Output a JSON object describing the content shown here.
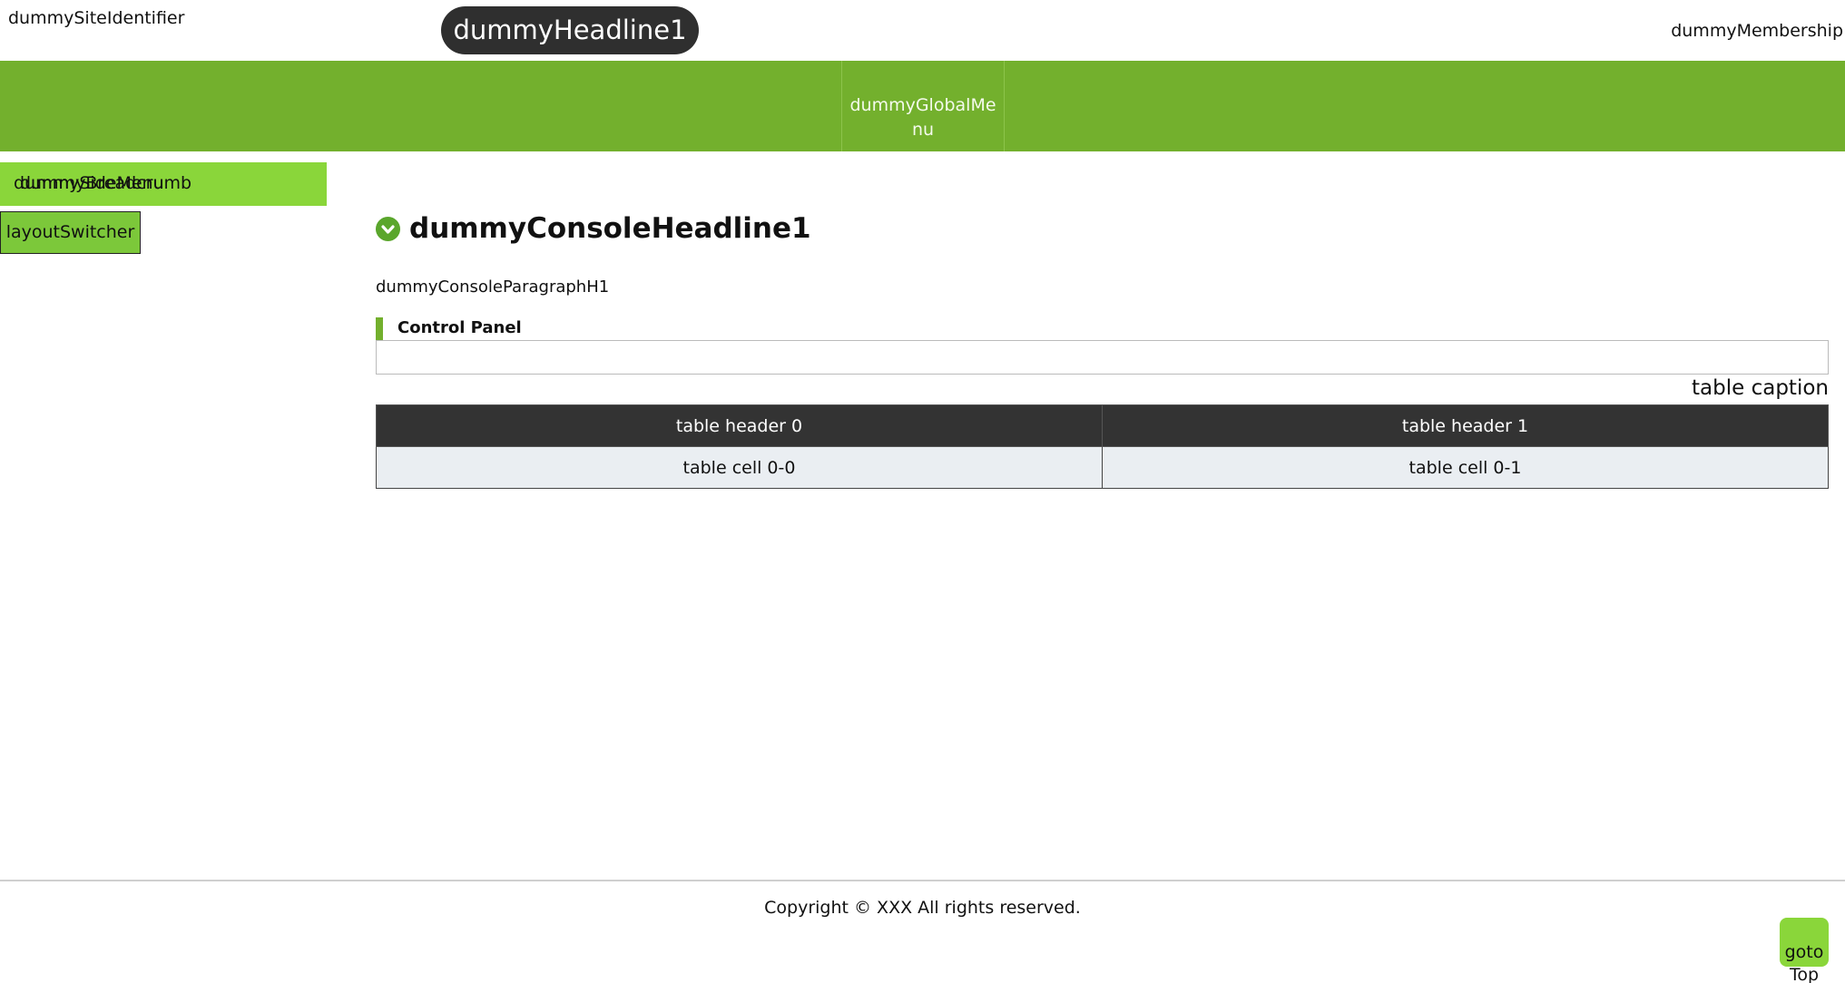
{
  "header": {
    "site_identifier": "dummySiteIdentifier",
    "headline": "dummyHeadline1",
    "membership": "dummyMembership"
  },
  "global_nav": {
    "items": [
      {
        "label": "dummyGlobalMenu"
      }
    ]
  },
  "sidebar": {
    "side_menu": "dummySideMenu",
    "breadcrumb": "dummyBreadcrumb",
    "layout_switcher": "layoutSwitcher"
  },
  "console": {
    "headline": "dummyConsoleHeadline1",
    "paragraph": "dummyConsoleParagraphH1",
    "panel_title": "Control Panel",
    "table": {
      "caption": "table caption",
      "headers": [
        "table header 0",
        "table header 1"
      ],
      "rows": [
        [
          "table cell 0-0",
          "table cell 0-1"
        ]
      ]
    }
  },
  "footer": {
    "copyright": "Copyright © XXX All rights reserved.",
    "goto_top": "gotoTop"
  },
  "colors": {
    "nav_green": "#73b02d",
    "light_green": "#8ad63a",
    "dark_pill": "#2f2f2f",
    "table_header": "#333333",
    "table_cell": "#eaeef2"
  }
}
